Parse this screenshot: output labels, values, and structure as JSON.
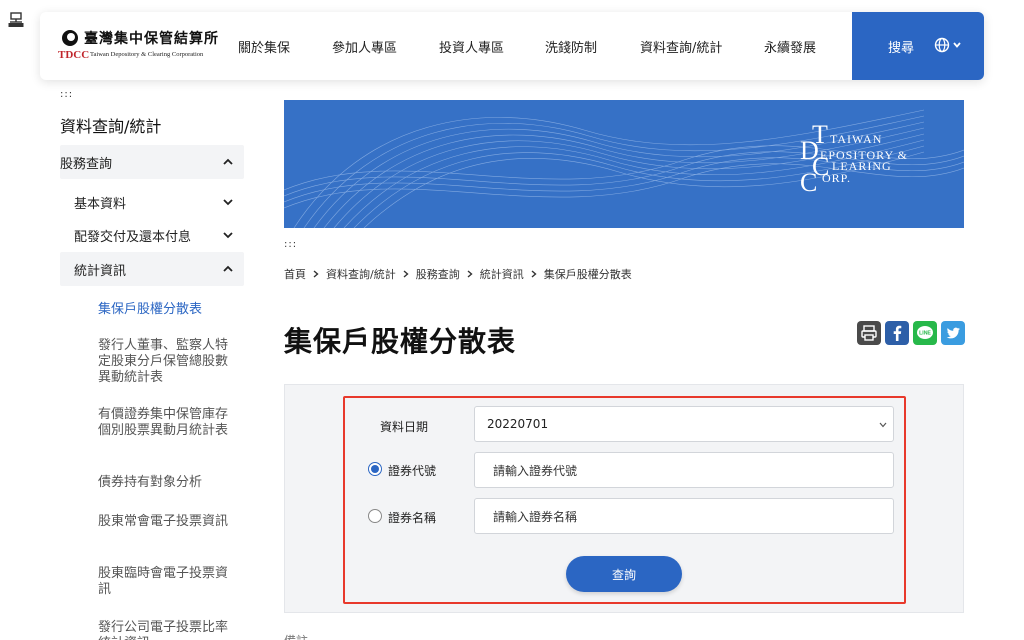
{
  "accessibility": {
    "top_dots": ":::",
    "side_dots": ":::",
    "content_dots": ":::"
  },
  "logo": {
    "cn": "臺灣集中保管結算所",
    "abbr": "TDCC",
    "en": "Taiwan Depository & Clearing Corporation"
  },
  "nav": {
    "items": [
      "關於集保",
      "參加人專區",
      "投資人專區",
      "洗錢防制",
      "資料查詢/統計",
      "永續發展"
    ],
    "search_label": "搜尋",
    "colors": {
      "accent": "#2b66c3"
    }
  },
  "sidebar": {
    "title": "資料查詢/統計",
    "section": {
      "label": "股務查詢"
    },
    "groups": [
      {
        "label": "基本資料"
      },
      {
        "label": "配發交付及還本付息"
      },
      {
        "label": "統計資訊"
      }
    ],
    "subitems": [
      "集保戶股權分散表",
      "發行人董事、監察人特定股東分戶保管總股數異動統計表",
      "有價證券集中保管庫存個別股票異動月統計表",
      "債券持有對象分析",
      "股東常會電子投票資訊",
      "股東臨時會電子投票資訊",
      "發行公司電子投票比率統計資訊"
    ]
  },
  "banner": {
    "line1": "TAIWAN",
    "line2": "EPOSITORY &",
    "line3": "LEARING",
    "line4": "ORP.",
    "letters": [
      "T",
      "D",
      "C",
      "C"
    ]
  },
  "breadcrumb": [
    "首頁",
    "資料查詢/統計",
    "股務查詢",
    "統計資訊",
    "集保戶股權分散表"
  ],
  "page": {
    "title": "集保戶股權分散表"
  },
  "share": {
    "line_label": "LINE"
  },
  "form": {
    "date_label": "資料日期",
    "date_value": "20220701",
    "code_label": "證券代號",
    "code_placeholder": "請輸入證券代號",
    "name_label": "證券名稱",
    "name_placeholder": "請輸入證券名稱",
    "submit_label": "查詢",
    "selected_option": "證券代號",
    "highlight_color": "#e8392c"
  },
  "below": {
    "cut_text": "備註"
  }
}
